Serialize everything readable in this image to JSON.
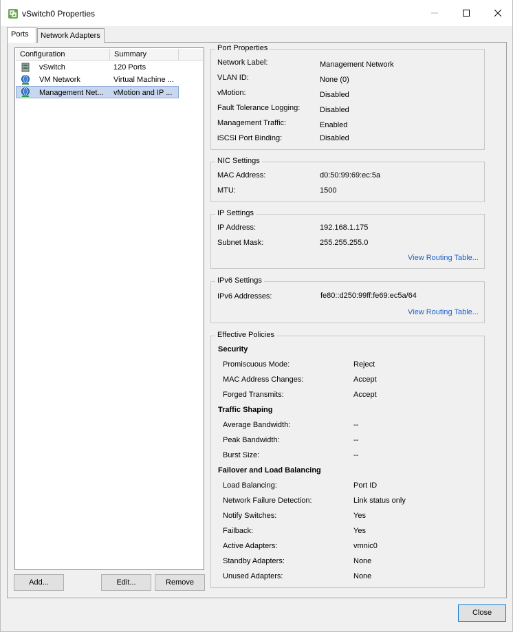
{
  "window": {
    "title": "vSwitch0 Properties"
  },
  "tabs": [
    "Ports",
    "Network Adapters"
  ],
  "list": {
    "headers": [
      "Configuration",
      "Summary"
    ],
    "rows": [
      {
        "icon": "vswitch-icon",
        "name": "vSwitch",
        "summary": "120 Ports"
      },
      {
        "icon": "vm-network-icon",
        "name": "VM Network",
        "summary": "Virtual Machine ..."
      },
      {
        "icon": "vmkernel-port-icon",
        "name": "Management Net...",
        "summary": "vMotion and IP ..."
      }
    ]
  },
  "buttons": {
    "add": "Add...",
    "edit": "Edit...",
    "remove": "Remove",
    "close": "Close"
  },
  "port_properties": {
    "title": "Port Properties",
    "rows": [
      {
        "label": "Network Label:",
        "value": "Management Network"
      },
      {
        "label": "VLAN ID:",
        "value": "None (0)"
      },
      {
        "label": "vMotion:",
        "value": "Disabled"
      },
      {
        "label": "Fault Tolerance Logging:",
        "value": "Disabled"
      },
      {
        "label": "Management Traffic:",
        "value": "Enabled"
      },
      {
        "label": "iSCSI Port Binding:",
        "value": "Disabled"
      }
    ]
  },
  "nic_settings": {
    "title": "NIC Settings",
    "rows": [
      {
        "label": "MAC Address:",
        "value": "d0:50:99:69:ec:5a"
      },
      {
        "label": "MTU:",
        "value": "1500"
      }
    ]
  },
  "ip_settings": {
    "title": "IP Settings",
    "rows": [
      {
        "label": "IP Address:",
        "value": "192.168.1.175"
      },
      {
        "label": "Subnet Mask:",
        "value": "255.255.255.0"
      }
    ],
    "link": "View Routing Table..."
  },
  "ipv6_settings": {
    "title": "IPv6 Settings",
    "rows": [
      {
        "label": "IPv6 Addresses:",
        "value": "fe80::d250:99ff:fe69:ec5a/64"
      }
    ],
    "link": "View Routing Table..."
  },
  "effective_policies": {
    "title": "Effective Policies",
    "security": {
      "title": "Security",
      "rows": [
        {
          "label": "Promiscuous Mode:",
          "value": "Reject"
        },
        {
          "label": "MAC Address Changes:",
          "value": "Accept"
        },
        {
          "label": "Forged Transmits:",
          "value": "Accept"
        }
      ]
    },
    "traffic_shaping": {
      "title": "Traffic Shaping",
      "rows": [
        {
          "label": "Average Bandwidth:",
          "value": "--"
        },
        {
          "label": "Peak Bandwidth:",
          "value": "--"
        },
        {
          "label": "Burst Size:",
          "value": "--"
        }
      ]
    },
    "failover": {
      "title": "Failover and Load Balancing",
      "rows": [
        {
          "label": "Load Balancing:",
          "value": "Port ID"
        },
        {
          "label": "Network Failure Detection:",
          "value": "Link status only"
        },
        {
          "label": "Notify Switches:",
          "value": "Yes"
        },
        {
          "label": "Failback:",
          "value": "Yes"
        },
        {
          "label": "Active Adapters:",
          "value": "vmnic0"
        },
        {
          "label": "Standby Adapters:",
          "value": "None"
        },
        {
          "label": "Unused Adapters:",
          "value": "None"
        }
      ]
    }
  }
}
